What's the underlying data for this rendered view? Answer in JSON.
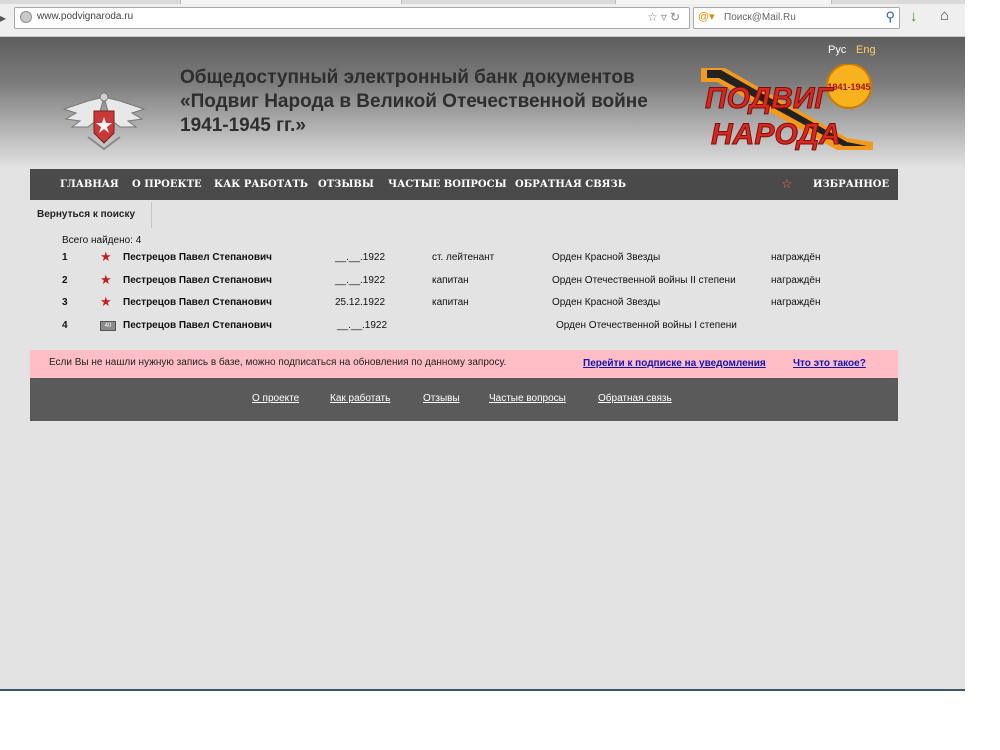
{
  "browser": {
    "url": "www.podvignaroda.ru",
    "search_placeholder": "Поиск@Mail.Ru"
  },
  "header": {
    "lang_ru": "Рус",
    "lang_en": "Eng",
    "title_lines": [
      "Общедоступный электронный банк документов",
      "«Подвиг Народа в Великой Отечественной войне",
      "1941-1945 гг.»"
    ],
    "logo_text_1": "ПОДВИГ",
    "logo_text_2": "НАРОДА",
    "logo_years": "1941-1945"
  },
  "nav": {
    "items": [
      "ГЛАВНАЯ",
      "О ПРОЕКТЕ",
      "КАК РАБОТАТЬ",
      "ОТЗЫВЫ",
      "ЧАСТЫЕ ВОПРОСЫ",
      "ОБРАТНАЯ СВЯЗЬ"
    ],
    "favorites": "ИЗБРАННОЕ"
  },
  "content": {
    "back_link": "Вернуться к поиску",
    "found_label": "Всего найдено: 4",
    "results": [
      {
        "num": "1",
        "icon": "red-star-icon",
        "name": "Пестрецов Павел Степанович",
        "date": "__.__.1922",
        "rank": "ст. лейтенант",
        "award": "Орден Красной Звезды",
        "status": "награждён"
      },
      {
        "num": "2",
        "icon": "red-star-icon",
        "name": "Пестрецов Павел Степанович",
        "date": "__.__.1922",
        "rank": "капитан",
        "award": "Орден Отечественной войны II степени",
        "status": "награждён"
      },
      {
        "num": "3",
        "icon": "red-star-icon",
        "name": "Пестрецов Павел Степанович",
        "date": "25.12.1922",
        "rank": "капитан",
        "award": "Орден Красной Звезды",
        "status": "награждён"
      },
      {
        "num": "4",
        "icon": "anniversary-badge-icon",
        "badge_text": "40",
        "name": "Пестрецов Павел Степанович",
        "date": "__.__.1922",
        "rank": "",
        "award": "Орден Отечественной войны I степени",
        "status": ""
      }
    ]
  },
  "notice": {
    "text": "Если Вы не нашли нужную запись в базе, можно подписаться на обновления по данному запросу.",
    "subscribe_link": "Перейти к подписке на уведомления",
    "whatisit_link": "Что это такое?"
  },
  "footer": {
    "links": [
      "О проекте",
      "Как работать",
      "Отзывы",
      "Частые вопросы",
      "Обратная связь"
    ]
  },
  "colors": {
    "nav_bg": "#4a4a4a",
    "notice_bg": "#ffbec6",
    "link_blue": "#1414b4",
    "accent_orange": "#e27845",
    "lang_active": "#ffcc66"
  }
}
